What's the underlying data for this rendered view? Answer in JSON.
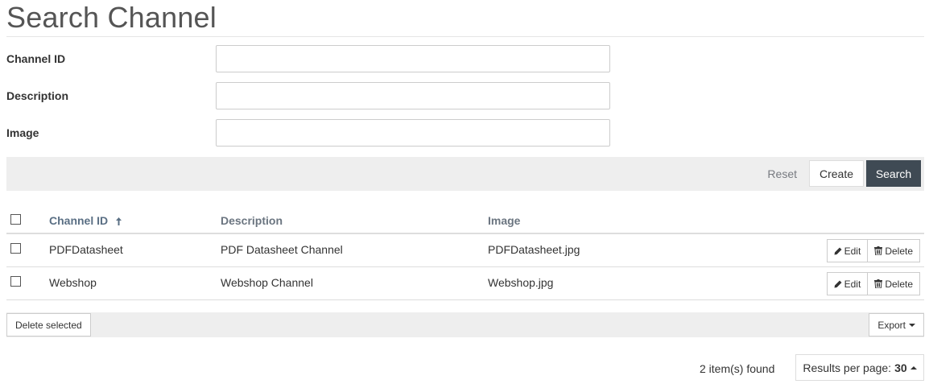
{
  "page": {
    "title": "Search Channel"
  },
  "form": {
    "fields": [
      {
        "label": "Channel ID",
        "value": "",
        "placeholder": ""
      },
      {
        "label": "Description",
        "value": "",
        "placeholder": ""
      },
      {
        "label": "Image",
        "value": "",
        "placeholder": ""
      }
    ]
  },
  "actions": {
    "reset": "Reset",
    "create": "Create",
    "search": "Search"
  },
  "table": {
    "columns": [
      "Channel ID",
      "Description",
      "Image"
    ],
    "sorted_column": "Channel ID",
    "sort_direction": "ascending",
    "rows": [
      {
        "id": "PDFDatasheet",
        "description": "PDF Datasheet Channel",
        "image": "PDFDatasheet.jpg"
      },
      {
        "id": "Webshop",
        "description": "Webshop Channel",
        "image": "Webshop.jpg"
      }
    ],
    "row_actions": {
      "edit": "Edit",
      "delete": "Delete"
    }
  },
  "footer": {
    "delete_selected": "Delete selected",
    "export": "Export",
    "items_found": "2 item(s) found",
    "results_per_page_label": "Results per page:",
    "results_per_page_value": "30"
  },
  "colors": {
    "search_button": "#3f4a54",
    "action_bar": "#eeeeee",
    "column_header": "#6b7580"
  },
  "icons": [
    "sort-up-arrow-icon",
    "pencil-icon",
    "trash-icon",
    "caret-down-icon",
    "caret-up-icon"
  ]
}
